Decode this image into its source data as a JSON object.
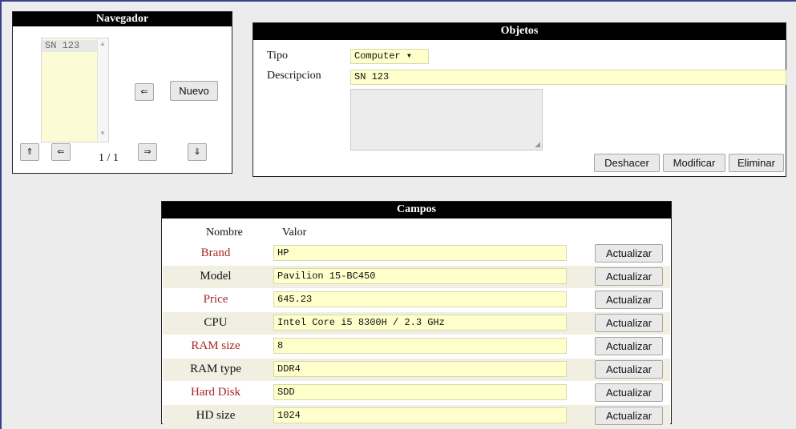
{
  "navegador": {
    "title": "Navegador",
    "list_items": [
      "SN 123"
    ],
    "scroll_up_icon": "▲",
    "scroll_down_icon": "▼",
    "collapse_glyph": "⇐",
    "new_label": "Nuevo",
    "first_glyph": "⇑",
    "prev_glyph": "⇐",
    "next_glyph": "⇒",
    "last_glyph": "⇓",
    "page": "1 / 1"
  },
  "objetos": {
    "title": "Objetos",
    "tipo_label": "Tipo",
    "tipo_value": "Computer ▾",
    "descripcion_label": "Descripcion",
    "descripcion_value": "SN 123",
    "textarea_value": "",
    "undo_label": "Deshacer",
    "modify_label": "Modificar",
    "delete_label": "Eliminar"
  },
  "campos": {
    "title": "Campos",
    "col_name": "Nombre",
    "col_value": "Valor",
    "update_label": "Actualizar",
    "rows": [
      {
        "name": "Brand",
        "value": "HP",
        "color": "#a5262a"
      },
      {
        "name": "Model",
        "value": "Pavilion 15-BC450",
        "color": "#111111"
      },
      {
        "name": "Price",
        "value": "645.23",
        "color": "#a5262a"
      },
      {
        "name": "CPU",
        "value": "Intel Core i5 8300H / 2.3 GHz",
        "color": "#111111"
      },
      {
        "name": "RAM size",
        "value": "8",
        "color": "#a5262a"
      },
      {
        "name": "RAM type",
        "value": "DDR4",
        "color": "#111111"
      },
      {
        "name": "Hard Disk",
        "value": "SDD",
        "color": "#a5262a"
      },
      {
        "name": "HD size",
        "value": "1024",
        "color": "#111111"
      }
    ]
  }
}
